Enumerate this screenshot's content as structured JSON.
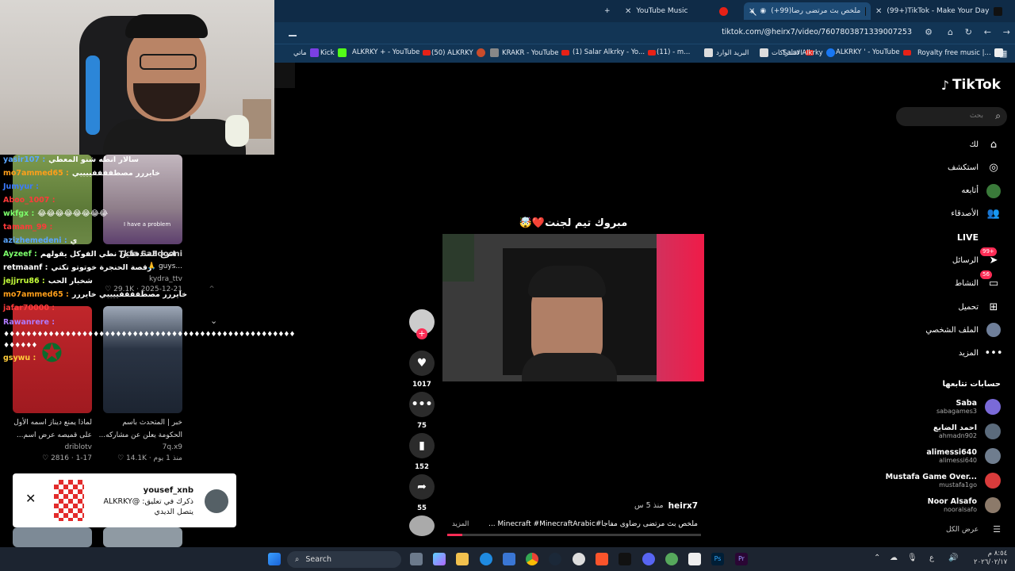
{
  "browser": {
    "tabs": [
      {
        "label": "YouTube Music",
        "active": false
      },
      {
        "label": "ملخص بث مرتضى رضا(99+)",
        "active": true
      },
      {
        "label": "(99+)TikTok - Make Your Day",
        "active": false
      }
    ],
    "new_tab": "+",
    "url": "tiktok.com/@heirx7/video/7607803871339007253",
    "bookmarks": [
      "ماتي",
      "Kick",
      "ALKRKY + - YouTube",
      "(50) ALKRKY",
      "KRAKR - YouTube",
      "(1) Salar Alkrky - Yo...",
      "(11) - m...",
      "البريد الوارد",
      "الاشتراكات",
      "Salar Alkrky",
      "ALKRKY ' - YouTube",
      "Royalty free music |..."
    ]
  },
  "stream": {
    "chat": [
      {
        "user": "yasir107 :",
        "msg": "سالار انطه شنو المعطي",
        "color": "#5aa6ff"
      },
      {
        "user": "mo7ammed65 :",
        "msg": "خايررر مصطففففييييي",
        "color": "#ff9f1a"
      },
      {
        "user": "Jumyur :",
        "msg": "",
        "color": "#3b7bff"
      },
      {
        "user": "Aboo_1007 :",
        "msg": "",
        "color": "#ff3a3a"
      },
      {
        "user": "wkfgx :",
        "msg": "😂😂😂😂😂😂😂😂",
        "color": "#7cff6b"
      },
      {
        "user": "tamam_99 :",
        "msg": "",
        "color": "#ff3a3a"
      },
      {
        "user": "azizhemedeni :",
        "msg": "ي",
        "color": "#5aa6ff"
      },
      {
        "user": "Ayzeef :",
        "msg": "انزع المتدفقين نطي الفوكل يقولهم",
        "color": "#7cff6b"
      },
      {
        "user": "retmaanf :",
        "msg": "رقصة الحنجرة خوتوتو تكتي",
        "color": "#ffffff"
      },
      {
        "user": "jejjrru86 :",
        "msg": "شخبار الحب",
        "color": "#c6ff3a"
      },
      {
        "user": "mo7ammed65 :",
        "msg": "خايررر مصطففففييييي خايررر",
        "color": "#ff9f1a"
      },
      {
        "user": "jafar70000 :",
        "msg": "",
        "color": "#ff3a3a"
      },
      {
        "user": "Rawanrere :",
        "msg": "",
        "color": "#b07bff"
      },
      {
        "user": "gsywu :",
        "msg": "",
        "color": "#ffcc3a"
      }
    ],
    "spam_line": "♦♦♦♦♦♦♦♦♦♦♦♦♦♦♦♦♦♦♦♦♦♦♦♦♦♦♦♦♦♦♦♦♦♦♦♦♦♦♦♦♦♦♦♦♦♦♦♦♦♦♦♦♦♦♦♦♦♦",
    "spam_line2": "♦♦♦♦♦♦",
    "thumb_cards": [
      {
        "title": "Tkfa Sa3dooni",
        "sub": "...guys 🙏",
        "meta": "kydra_ttv",
        "date": "2025-12-21 · 29.1K ♡"
      },
      {
        "title": "لماذا يمنع ديناز اسمه الأول",
        "sub": "على قميصه عرض اسم...",
        "meta": "driblotv",
        "date": "1-17 · 2816 ♡"
      },
      {
        "title": "خبر | المتحدث باسم",
        "sub": "الحكومة يعلن عن مشاركه...",
        "meta": "7q.x9",
        "date": "منذ 1 يوم · 14.1K ♡"
      }
    ],
    "thumb_overlay": "I have a problem",
    "notification": {
      "user": "yousef_xnb",
      "line1": "ذكرك في تعليق: @ALKRKY",
      "line2": "يتصل الديدي"
    }
  },
  "tiktok": {
    "logo": "TikTok",
    "search_placeholder": "بحث",
    "nav": [
      {
        "label": "لك",
        "icon": "home-icon"
      },
      {
        "label": "استكشف",
        "icon": "compass-icon"
      },
      {
        "label": "أتابعه",
        "icon": "following-icon"
      },
      {
        "label": "الأصدقاء",
        "icon": "friends-icon"
      },
      {
        "label": "LIVE",
        "icon": "live-icon"
      },
      {
        "label": "الرسائل",
        "icon": "messages-icon",
        "badge": "99+"
      },
      {
        "label": "النشاط",
        "icon": "activity-icon",
        "badge": "56"
      },
      {
        "label": "تحميل",
        "icon": "upload-icon"
      },
      {
        "label": "الملف الشخصي",
        "icon": "profile-icon"
      },
      {
        "label": "المزيد",
        "icon": "more-icon"
      }
    ],
    "following_title": "حسابات تتابعها",
    "following": [
      {
        "name": "Saba",
        "handle": "sabagames3",
        "color": "#7a6ad8"
      },
      {
        "name": "احمد الضايع",
        "handle": "ahmadn902",
        "color": "#5b6b7c"
      },
      {
        "name": "alimessi640",
        "handle": "alimessi640",
        "color": "#6f7d8e"
      },
      {
        "name": "Mustafa Game Over...",
        "handle": "mustafa1go",
        "color": "#d93b3b"
      },
      {
        "name": "Noor Alsafo",
        "handle": "nooralsafo",
        "color": "#8c7a6a"
      }
    ],
    "see_all": "عرض الكل",
    "video": {
      "caption_overlay": "مبروك تيم لجنت❤️🤯",
      "author": "heirx7",
      "time": "منذ 5 س",
      "description": "ملخص بث مرتضى رضاوى مفاجأ#Minecraft #MinecraftArabic ...",
      "more": "المزيد",
      "progress": 0.06
    },
    "actions": {
      "likes": "1017",
      "comments": "75",
      "saves": "152",
      "shares": "55"
    }
  },
  "taskbar": {
    "search": "Search",
    "lang": "ع",
    "time": "٨:٥٤ م",
    "date": "٢٠٢٦/٠٢/١٧"
  }
}
